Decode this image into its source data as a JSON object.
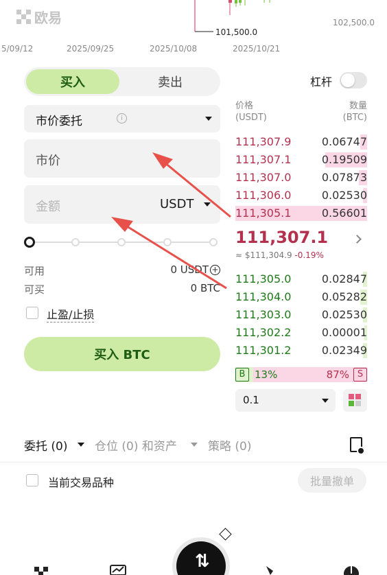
{
  "chart_strip": {
    "logo_text": "欧易",
    "price_marker": "101,500.0",
    "price_right": "102,500.0",
    "dates": [
      "5/09/12",
      "2025/09/25",
      "2025/10/08",
      "2025/10/21"
    ]
  },
  "order_form": {
    "side_buy": "买入",
    "side_sell": "卖出",
    "leverage_label": "杠杆",
    "order_type": "市价委托",
    "price_field": "市价",
    "amount_placeholder": "金额",
    "amount_unit": "USDT",
    "available_label": "可用",
    "available_value": "0 USDT",
    "buyable_label": "可买",
    "buyable_value": "0 BTC",
    "tpsl_label": "止盈/止损",
    "submit_label": "买入 BTC",
    "slider_percent": 0
  },
  "order_book": {
    "price_header": "价格",
    "price_unit": "(USDT)",
    "qty_header": "数量",
    "qty_unit": "(BTC)",
    "asks": [
      {
        "price": "111,307.9",
        "qty": "0.06747",
        "depth": 0.05
      },
      {
        "price": "111,307.1",
        "qty": "0.19509",
        "depth": 0.32
      },
      {
        "price": "111,307.0",
        "qty": "0.07873",
        "depth": 0.06
      },
      {
        "price": "111,306.0",
        "qty": "0.02530",
        "depth": 0.03
      },
      {
        "price": "111,305.1",
        "qty": "0.56601",
        "depth": 1.0
      }
    ],
    "last_price": "111,307.1",
    "index_price": "≈ $111,304.9",
    "change": "-0.19%",
    "bids": [
      {
        "price": "111,305.0",
        "qty": "0.02847",
        "depth": 0.03
      },
      {
        "price": "111,304.0",
        "qty": "0.05282",
        "depth": 0.05
      },
      {
        "price": "111,303.0",
        "qty": "0.02530",
        "depth": 0.03
      },
      {
        "price": "111,302.2",
        "qty": "0.00001",
        "depth": 0.01
      },
      {
        "price": "111,301.2",
        "qty": "0.02349",
        "depth": 0.03
      }
    ],
    "ratio_buy_label": "B",
    "ratio_buy": "13%",
    "ratio_sell": "87%",
    "ratio_sell_label": "S",
    "depth_step": "0.1"
  },
  "bottom_tabs": {
    "orders": "委托 (0)",
    "positions": "仓位 (0) 和资产",
    "strategies": "策略 (0)",
    "current_pair_label": "当前交易品种",
    "batch_cancel": "批量撤单"
  },
  "colors": {
    "buy_accent": "#cdeba5",
    "ask_red": "#b3314f",
    "bid_green": "#1e7a18",
    "annotation_arrow": "#e8504a"
  }
}
